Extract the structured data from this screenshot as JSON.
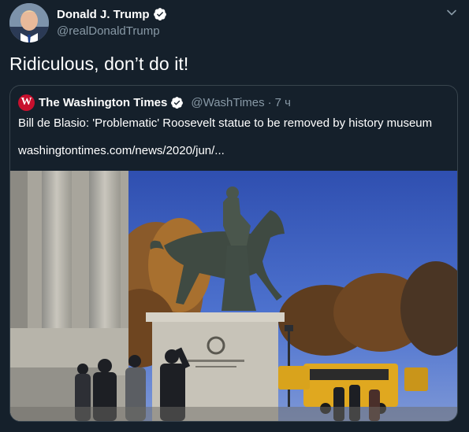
{
  "author": {
    "display_name": "Donald J. Trump",
    "handle": "@realDonaldTrump"
  },
  "tweet": {
    "text": "Ridiculous, don’t do it!"
  },
  "quoted_tweet": {
    "logo_letter": "W",
    "display_name": "The Washington Times",
    "handle": "@WashTimes",
    "separator": "·",
    "time": "7 ч",
    "text": "Bill de Blasio: 'Problematic' Roosevelt statue to be removed by history museum",
    "link": "washingtontimes.com/news/2020/jun/..."
  },
  "icons": {
    "verified": "verified-badge-icon",
    "caret": "chevron-down-icon"
  },
  "colors": {
    "background": "#15202b",
    "text_primary": "#ffffff",
    "text_secondary": "#8899a6",
    "border": "#38444d",
    "verified_blue": "#1da1f2",
    "logo_red": "#c8102e"
  }
}
